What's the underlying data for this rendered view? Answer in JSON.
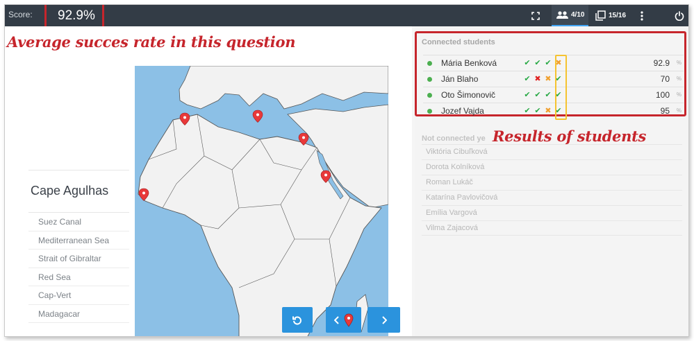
{
  "topbar": {
    "score_label": "Score:",
    "score_value": "92.9%",
    "students_count": "4/10",
    "questions_count": "15/16"
  },
  "icons": {
    "fullscreen": "fullscreen-icon",
    "students": "people-icon",
    "questions": "copy-icon",
    "more": "more-vertical-icon",
    "power": "power-icon",
    "reset": "rotate-icon",
    "prev": "chevron-left-icon",
    "next": "chevron-right-icon",
    "marker": "map-pin-icon"
  },
  "annotations": {
    "average": "Average succes rate in this question",
    "results": "Results of students"
  },
  "question": {
    "current_answer": "Cape Agulhas",
    "options": [
      "Suez Canal",
      "Mediterranean Sea",
      "Strait of Gibraltar",
      "Red Sea",
      "Cap-Vert",
      "Madagacar"
    ]
  },
  "connected": {
    "title": "Connected students",
    "students": [
      {
        "name": "Mária Benková",
        "marks": [
          "ok",
          "ok",
          "ok",
          "part"
        ],
        "score": "92.9",
        "unit": "%"
      },
      {
        "name": "Ján Blaho",
        "marks": [
          "ok",
          "bad",
          "part",
          "ok"
        ],
        "score": "70",
        "unit": "%"
      },
      {
        "name": "Oto Šimonovič",
        "marks": [
          "ok",
          "ok",
          "ok",
          "ok"
        ],
        "score": "100",
        "unit": "%"
      },
      {
        "name": "Jozef Vajda",
        "marks": [
          "ok",
          "ok",
          "part",
          "ok"
        ],
        "score": "95",
        "unit": "%"
      }
    ]
  },
  "not_connected": {
    "title": "Not connected ye",
    "students": [
      "Viktória Cibuľková",
      "Dorota Kolníková",
      "Roman Lukáč",
      "Katarína Pavlovičová",
      "Emília Vargová",
      "Vilma Zajacová"
    ]
  },
  "colors": {
    "topbar": "#333c46",
    "accent": "#2b93dd",
    "annotation": "#c6252c",
    "highlight": "#f5c330",
    "sea": "#8cc0e6"
  }
}
